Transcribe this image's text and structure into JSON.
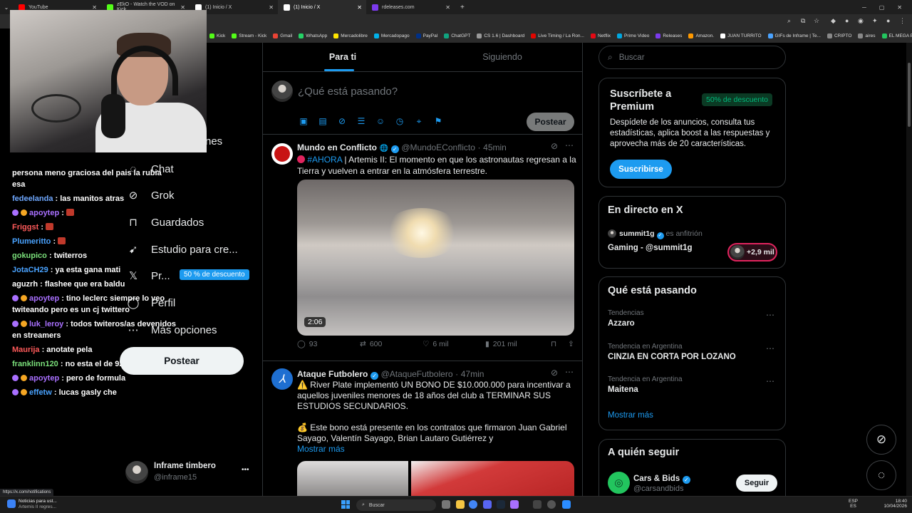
{
  "browser": {
    "tabs": [
      {
        "title": "YouTube",
        "color": "#ff0000"
      },
      {
        "title": "zEkO - Watch the VOD on Kick",
        "color": "#53fc18"
      },
      {
        "title": "(1) Inicio / X",
        "color": "#ffffff"
      },
      {
        "title": "(1) Inicio / X",
        "color": "#ffffff",
        "active": true
      },
      {
        "title": "rdeleases.com",
        "color": "#7c3aed"
      }
    ],
    "new_tab": "+",
    "bookmarks": [
      "Kick",
      "Stream - Kick",
      "Gmail",
      "WhatsApp",
      "Mercadolibre",
      "Mercadopago",
      "PayPal",
      "ChatGPT",
      "CS 1.6 | Dashboard",
      "Live Timing / La Ron...",
      "Netflix",
      "Prime Video",
      "Releases",
      "Amazon.",
      "JUAN TURRITO",
      "GIFs de Inframe | Te...",
      "CRIPTO",
      "aires",
      "EL MEGA PACK PAP..."
    ],
    "status_url": "https://x.com/notifications"
  },
  "chat": [
    {
      "user": "",
      "color": "#ffffff",
      "msg": "persona meno graciosa del pais la rubia esa",
      "wrap": true
    },
    {
      "user": "fedeelanda",
      "color": "#6fa8ff",
      "msg": "las manitos atras"
    },
    {
      "user": "apoytep",
      "color": "#a970ff",
      "msg": "",
      "badges": true
    },
    {
      "user": "Friggst",
      "color": "#ff5a5a",
      "msg": ""
    },
    {
      "user": "Plumeritto",
      "color": "#4aa3ff",
      "msg": ""
    },
    {
      "user": "gokupico",
      "color": "#7be07b",
      "msg": "twiterros"
    },
    {
      "user": "JotaCH29",
      "color": "#4aa3ff",
      "msg": "ya esta gana mati"
    },
    {
      "user": "aguzrh",
      "color": "#ffffff",
      "msg": "flashee que era baldu"
    },
    {
      "user": "apoytep",
      "color": "#a970ff",
      "msg": "tino leclerc siempre lo veo twiteando pero es un cj twittero",
      "badges": true,
      "wrap": true
    },
    {
      "user": "luk_leroy",
      "color": "#a970ff",
      "msg": "todos twiteros/as devenidos en streamers",
      "badges": true,
      "wrap": true
    },
    {
      "user": "Maurija",
      "color": "#ff5a5a",
      "msg": "anotate pela"
    },
    {
      "user": "franklinn120",
      "color": "#7be07b",
      "msg": "no esta el de 9z?"
    },
    {
      "user": "apoytep",
      "color": "#a970ff",
      "msg": "pero de formula",
      "badges": true
    },
    {
      "user": "effetw",
      "color": "#4aa3ff",
      "msg": "lucas gasly che",
      "badges": true
    }
  ],
  "nav": {
    "partial_top": "nes",
    "items": [
      {
        "label": "Chat",
        "icon": "chat-icon",
        "glyph": "◌"
      },
      {
        "label": "Grok",
        "icon": "grok-icon",
        "glyph": "⊘"
      },
      {
        "label": "Guardados",
        "icon": "bookmark-icon",
        "glyph": "⊓"
      },
      {
        "label": "Estudio para cre...",
        "icon": "rocket-icon",
        "glyph": "➹"
      },
      {
        "label": "Pr...",
        "icon": "x-premium-icon",
        "glyph": "𝕏"
      },
      {
        "label": "Perfil",
        "icon": "profile-icon",
        "glyph": "◯"
      },
      {
        "label": "Más opciones",
        "icon": "more-options-icon",
        "glyph": "⋯"
      }
    ],
    "premium_pill": "50 % de descuento",
    "post_button": "Postear",
    "account_name": "Inframe timbero",
    "account_handle": "@inframe15",
    "account_menu": "•••"
  },
  "feed": {
    "tabs": [
      "Para ti",
      "Siguiendo"
    ],
    "composer_placeholder": "¿Qué está pasando?",
    "composer_post": "Postear",
    "posts": [
      {
        "name": "Mundo en Conflicto",
        "handle": "@MundoEConflicto",
        "time": "45min",
        "hashtag": "#AHORA",
        "text": " | Artemis II: El momento en que los astronautas regresan a la Tierra y vuelven a entrar en la atmósfera terrestre.",
        "video_duration": "2:06",
        "replies": "93",
        "reposts": "600",
        "likes": "6 mil",
        "views": "201 mil"
      },
      {
        "name": "Ataque Futbolero",
        "handle": "@AtaqueFutbolero",
        "time": "47min",
        "text1": "⚠️ River Plate implementó UN BONO DE $10.000.000 para incentivar a aquellos juveniles menores de 18 años del club a TERMINAR SUS ESTUDIOS SECUNDARIOS.",
        "text2": "💰 Este bono está presente en los contratos que firmaron Juan Gabriel Sayago, Valentín Sayago, Brian Lautaro Gutiérrez y",
        "show_more": "Mostrar más"
      }
    ]
  },
  "sidebar": {
    "search_placeholder": "Buscar",
    "premium": {
      "title": "Suscríbete a Premium",
      "badge": "50% de descuento",
      "desc": "Despídete de los anuncios, consulta tus estadísticas, aplica boost a las respuestas y aprovecha más de 20 características.",
      "button": "Suscribirse"
    },
    "live": {
      "title": "En directo en X",
      "host": "summit1g",
      "host_suffix": "es anfitrión",
      "stream": "Gaming - @summit1g",
      "listeners": "+2,9 mil"
    },
    "trends": {
      "title": "Qué está pasando",
      "items": [
        {
          "category": "Tendencias",
          "name": "Azzaro"
        },
        {
          "category": "Tendencia en Argentina",
          "name": "CINZIA EN CORTA POR LOZANO"
        },
        {
          "category": "Tendencia en Argentina",
          "name": "Maitena"
        }
      ],
      "show_more": "Mostrar más"
    },
    "follow": {
      "title": "A quién seguir",
      "name": "Cars & Bids",
      "handle": "@carsandbids",
      "button": "Seguir"
    }
  },
  "taskbar": {
    "news_title": "Noticias para ust...",
    "news_sub": "Artemis II regres...",
    "search": "Buscar",
    "lang": "ESP",
    "lang_sub": "ES",
    "time": "18:40",
    "date": "10/04/2026"
  }
}
